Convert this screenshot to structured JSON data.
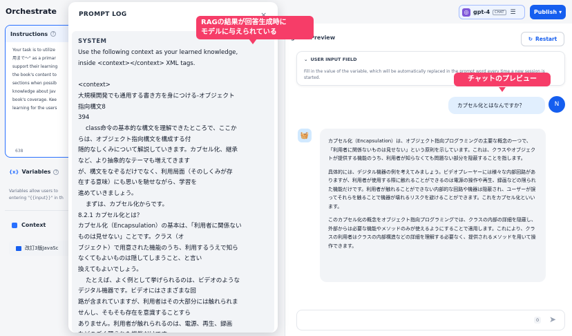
{
  "header": {
    "app_title": "Orchestrate",
    "model_name": "gpt-4",
    "model_badge": "CHAT",
    "publish_label": "Publish"
  },
  "config": {
    "instructions_title": "Instructions",
    "instructions_text": "Your task is to utilize\n用まで〜\" as a primar\nsupport their learning\nthe book's content to\nsections when possib\nknowledge about Jav\nbook's coverage. Kee\nlearning for the users",
    "instructions_count": "638",
    "variables_title": "Variables",
    "variables_desc": "Variables allow users to\nentering \"{{input}}\" in th",
    "context_title": "Context",
    "context_item": "改訂3版JavaSc"
  },
  "prompt_log": {
    "title": "PROMPT LOG",
    "role": "SYSTEM",
    "text": "Use the following context as your learned knowledge,\ninside <context></context> XML tags.\n\n<context>\n大規模開発でも通用する書き方を身につける-オブジェクト\n指向構文8\n394\n    class命令の基本的な構文を理解できたところで、ここか\nらは、オブジェクト指向構文を構成する付\n随的なしくみについて解説していきます。カプセル化、継承\nなど、より抽象的なテーマも増えてきます\nが、構文をなぞるだけでなく、利用局面（そのしくみが存\n在する意味）にも思いを馳せながら、学習を\n進めていきましょう。\n    まずは、カプセル化からです。\n8.2.1 カプセル化とは？\nカプセル化（Encapsulation）の基本は、「利用者に関係ない\nものは見せない」ことです。クラス（オ\nブジェクト）で用意された機能のうち、利用するうえで知ら\nなくてもよいものは隠してしまうこと、と言い\n換えてもよいでしょう。\n    たとえば、よく例として挙げられるのは、ビデオのような\nデジタル機器です。ビデオにはさまざまな回\n路が含まれていますが、利用者はその大部分には触れられま\nせんし、そもそも存在を意識することすら\nありません。利用者が触れられるのは、電源、再生、録画\nなどのごく限られた機能だけです。"
  },
  "callouts": {
    "rag": "RAGの結果が回答生成時に\nモデルに与えられている",
    "chat_preview": "チャットのプレビュー"
  },
  "preview": {
    "title": "g and Preview",
    "restart_label": "Restart",
    "input_field_title": "USER INPUT FIELD",
    "input_field_desc": "Fill in the value of the variable, which will be automatically replaced in the prompt word every time a new session is started.",
    "user_message": "カプセル化とはなんですか？",
    "user_avatar": "N",
    "bot_paragraphs": [
      "カプセル化（Encapsulation）は、オブジェクト指向プログラミングの主要な概念の一つで、「利用者に関係ないものは見せない」という原則を示しています。これは、クラスやオブジェクトが提供する機能のうち、利用者が知らなくても問題ない部分を隠蔽することを指します。",
      "具体的には、デジタル機器の例を考えてみましょう。ビデオプレーヤーには様々な内部回路がありますが、利用者が使用する際に触れることができるのは電源の操作や再生、録画などの限られた機能だけです。利用者が触れることができない内部的な回路や機器は隠蔽され、ユーザーが誤ってそれらを触ることで機器が壊れるリスクを避けることができます。これをカプセル化といいます。",
      "このカプセル化の概念をオブジェクト指向プログラミングでは、クラスの内部の詳細を隠蔽し、外部からは必要な機能やメソッドのみが使えるようにすることで適用します。これにより、クラスの利用者はクラスの内部構造などの詳細を理解する必要なく、提供されるメソッドを用いて操作できます。"
    ],
    "char_count": "0"
  },
  "colors": {
    "accent": "#155eef",
    "callout": "#f63d68"
  }
}
